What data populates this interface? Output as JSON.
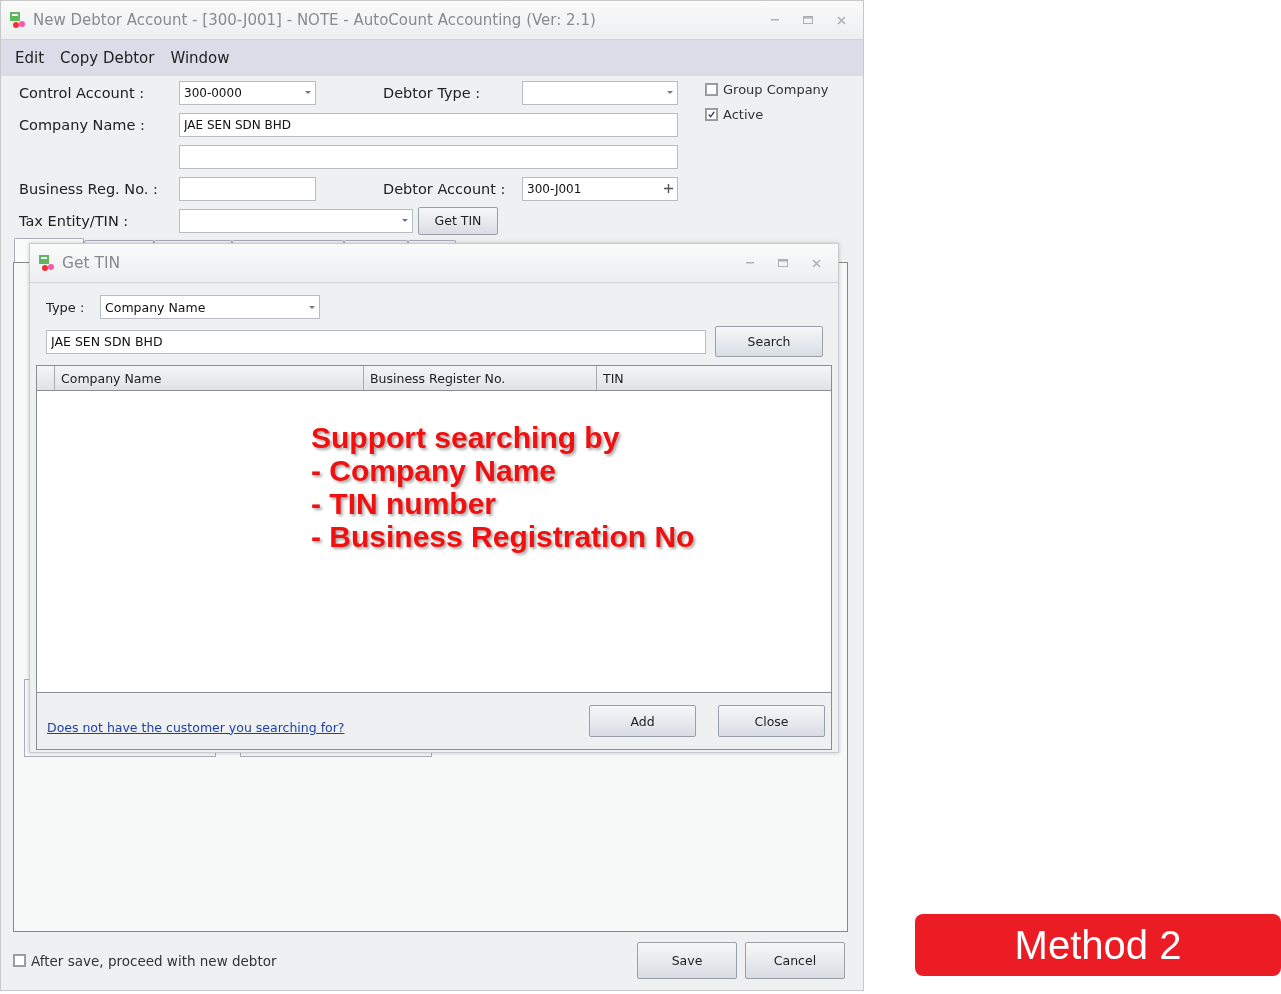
{
  "window": {
    "title": "New Debtor Account - [300-J001] - NOTE - AutoCount Accounting (Ver: 2.1)"
  },
  "menu": [
    "Edit",
    "Copy Debtor",
    "Window"
  ],
  "form": {
    "control_account": {
      "label": "Control Account :",
      "value": "300-0000"
    },
    "debtor_type": {
      "label": "Debtor Type :"
    },
    "company_name": {
      "label": "Company Name :",
      "value": "JAE SEN SDN BHD"
    },
    "business_reg": {
      "label": "Business Reg. No. :"
    },
    "debtor_account": {
      "label": "Debtor Account :",
      "value": "300-J001"
    },
    "tax_entity": {
      "label": "Tax Entity/TIN :",
      "button": "Get TIN"
    }
  },
  "options": [
    {
      "label": "Group Company",
      "checked": false
    },
    {
      "label": "Active",
      "checked": true
    }
  ],
  "tabs": [
    {
      "selected": true
    },
    {
      "selected": false
    },
    {
      "selected": false
    },
    {
      "selected": false
    },
    {
      "selected": false
    },
    {
      "selected": false
    }
  ],
  "after_save": {
    "label": "After save, proceed with new debtor",
    "checked": false
  },
  "buttons": [
    "Save",
    "Cancel"
  ],
  "dialog": {
    "title": "Get TIN",
    "type_label": "Type :",
    "type_value": "Company Name",
    "search_value": "JAE SEN SDN BHD",
    "search_button": "Search",
    "columns": [
      "Company Name",
      "Business Register No.",
      "TIN"
    ],
    "link": "Does not have the customer you searching for?",
    "buttons": [
      "Add",
      "Close"
    ]
  },
  "annotation": [
    "Support searching by",
    "- Company Name",
    "- TIN number",
    "- Business Registration No"
  ],
  "badge": "Method 2"
}
